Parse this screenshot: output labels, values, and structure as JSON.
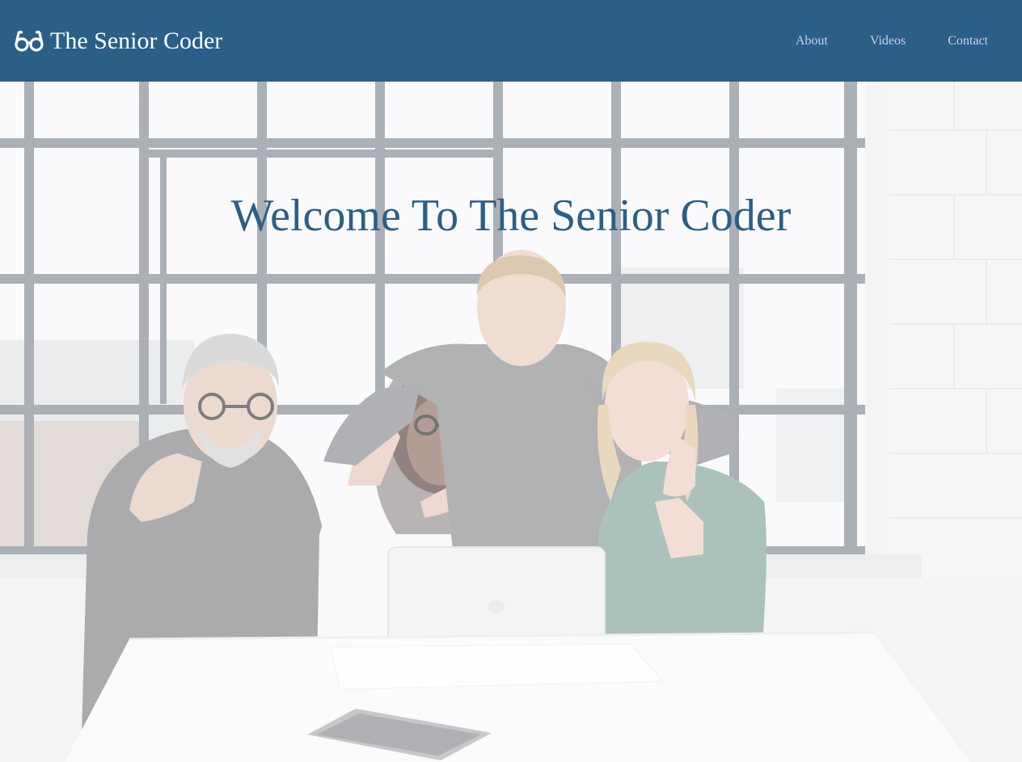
{
  "header": {
    "brand_name": "The Senior Coder",
    "brand_icon": "glasses-icon",
    "background_color": "#2a5f88",
    "nav": {
      "about": "About",
      "videos": "Videos",
      "contact": "Contact"
    }
  },
  "hero": {
    "title": "Welcome To The Senior Coder",
    "title_color": "#2a5f88",
    "image_subject": "group of smiling people giving thumbs up around a laptop in a bright office",
    "overlay": "white wash over photo"
  }
}
